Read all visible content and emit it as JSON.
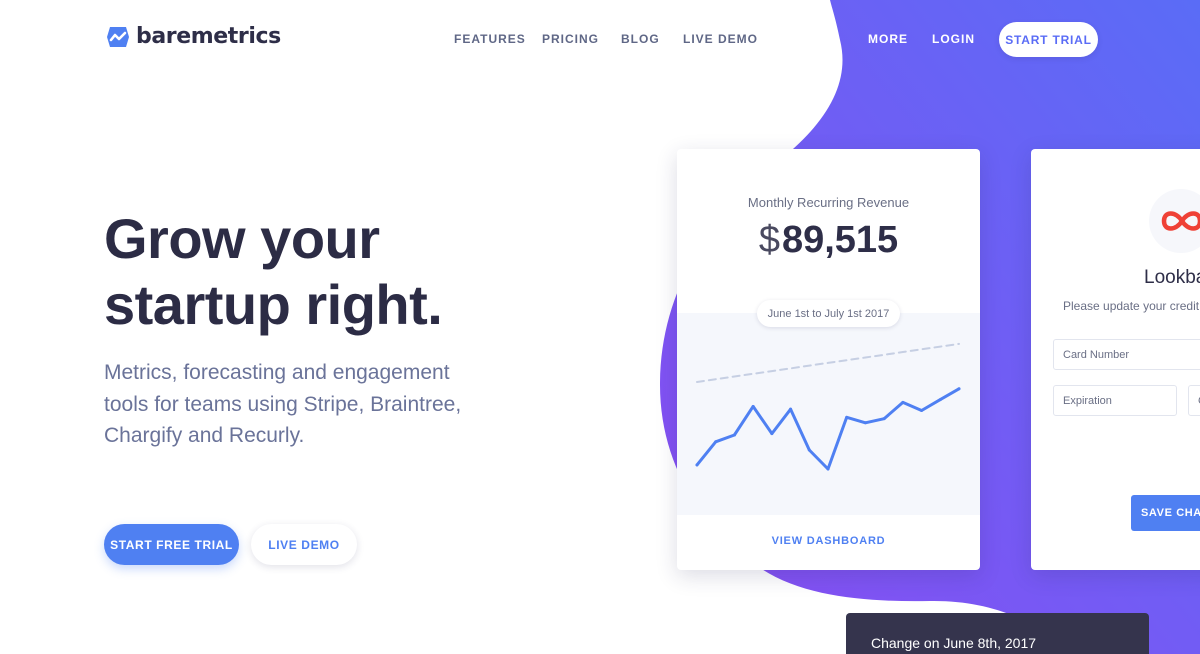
{
  "brand": {
    "name": "baremetrics",
    "accent": "#4f80f2",
    "gradient_start": "#8a4cf2",
    "gradient_end": "#5a6cf6",
    "logo_icon": "baremetrics-logo-icon"
  },
  "nav": {
    "links": [
      "FEATURES",
      "PRICING",
      "BLOG",
      "LIVE DEMO"
    ],
    "more": "MORE",
    "login": "LOGIN",
    "trial": "START TRIAL"
  },
  "hero": {
    "title_line1": "Grow your",
    "title_line2": "startup right.",
    "subtitle": "Metrics, forecasting and engagement tools for teams using Stripe, Braintree, Chargify and Recurly.",
    "cta_primary": "START FREE TRIAL",
    "cta_secondary": "LIVE DEMO"
  },
  "mrr_card": {
    "label": "Monthly Recurring Revenue",
    "currency": "$",
    "value": "89,515",
    "date_range": "June 1st to July 1st 2017",
    "link": "VIEW DASHBOARD"
  },
  "chart_data": {
    "type": "line",
    "title": "",
    "xlabel": "",
    "ylabel": "",
    "grid": false,
    "legend": "none",
    "x": [
      1,
      2,
      3,
      4,
      5,
      6,
      7,
      8,
      9,
      10,
      11,
      12,
      13,
      14,
      15
    ],
    "series": [
      {
        "values": [
          3,
          20,
          25,
          46,
          26,
          44,
          14,
          0,
          38,
          34,
          37,
          49,
          43,
          51,
          59
        ],
        "color": "#4f80f2",
        "style": "solid"
      },
      {
        "values": [
          64,
          66,
          68,
          70,
          72,
          74,
          76,
          78,
          80,
          82,
          84,
          86,
          88,
          90,
          92
        ],
        "color": "#c6cfe3",
        "style": "dashed"
      }
    ],
    "ylim": [
      0,
      100
    ]
  },
  "payment_card": {
    "logo_icon": "infinity-icon",
    "title": "Lookba",
    "subtitle": "Please update your credit",
    "card_placeholder": "Card Number",
    "exp_placeholder": "Expiration",
    "cvc_placeholder": "C",
    "save_label": "SAVE CHAN"
  },
  "change_card": {
    "text": "Change on June 8th, 2017"
  }
}
